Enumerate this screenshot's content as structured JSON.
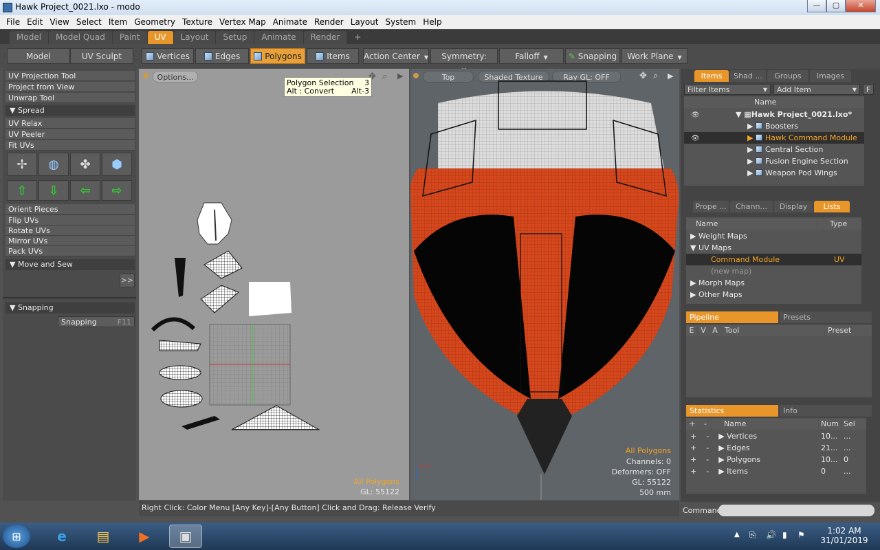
{
  "window": {
    "title": "Hawk Project_0021.lxo - modo",
    "min": "—",
    "max": "▢",
    "close": "✕"
  },
  "menu": [
    "File",
    "Edit",
    "View",
    "Select",
    "Item",
    "Geometry",
    "Texture",
    "Vertex Map",
    "Animate",
    "Render",
    "Layout",
    "System",
    "Help"
  ],
  "layout_tabs": [
    "Model",
    "Model Quad",
    "Paint",
    "UV",
    "Layout",
    "Setup",
    "Animate",
    "Render",
    "+"
  ],
  "active_layout_tab": "UV",
  "toolbar": {
    "model": "Model",
    "uv_sculpt": "UV Sculpt",
    "vertices": "Vertices",
    "edges": "Edges",
    "polygons": "Polygons",
    "items": "Items",
    "action_center": "Action Center",
    "symmetry": "Symmetry: Off",
    "falloff": "Falloff",
    "snapping": "Snapping",
    "work_plane": "Work Plane"
  },
  "left": {
    "tools1": [
      "UV Projection Tool",
      "Project from View",
      "Unwrap Tool"
    ],
    "spread": "Spread",
    "tools2": [
      "UV Relax",
      "UV Peeler",
      "Fit UVs"
    ],
    "tools3": [
      "Orient Pieces",
      "Flip UVs",
      "Rotate UVs",
      "Mirror UVs",
      "Pack UVs"
    ],
    "move_sew": "Move and Sew",
    "expand": ">>",
    "snapping_section": "Snapping",
    "snapping_btn": "Snapping",
    "snapping_key": "F11"
  },
  "uv_view": {
    "options": "Options...",
    "tooltip_title": "Polygon Selection",
    "tooltip_key1": "3",
    "tooltip_line2": "Alt : Convert",
    "tooltip_key2": "Alt-3",
    "all_polygons": "All Polygons",
    "gl": "GL: 55122"
  },
  "viewport": {
    "view": "Top",
    "shading": "Shaded Texture",
    "raygl": "Ray GL: OFF",
    "all_polygons": "All Polygons",
    "channels": "Channels: 0",
    "deformers": "Deformers: OFF",
    "gl": "GL: 55122",
    "scale": "500 mm"
  },
  "status": "Right Click: Color Menu  [Any Key]-[Any Button] Click and Drag: Release Verify",
  "items_panel": {
    "tabs": [
      "Items",
      "Shad ...",
      "Groups",
      "Images"
    ],
    "filter": "Filter Items",
    "add": "Add Item",
    "f": "F",
    "name_header": "Name",
    "rows": [
      {
        "label": "Hawk Project_0021.lxo*",
        "level": 0
      },
      {
        "label": "Boosters",
        "level": 1
      },
      {
        "label": "Hawk Command Module",
        "level": 1
      },
      {
        "label": "Central Section",
        "level": 1
      },
      {
        "label": "Fusion Engine Section",
        "level": 1
      },
      {
        "label": "Weapon Pod Wings",
        "level": 1
      }
    ]
  },
  "lists_panel": {
    "tabs": [
      "Prope ...",
      "Chann...",
      "Display",
      "Lists"
    ],
    "name": "Name",
    "type": "Type",
    "rows": [
      {
        "label": "Weight Maps",
        "type": ""
      },
      {
        "label": "UV Maps",
        "type": ""
      },
      {
        "label": "Command Module",
        "type": "UV"
      },
      {
        "label": "(new map)",
        "type": ""
      },
      {
        "label": "Morph Maps",
        "type": ""
      },
      {
        "label": "Other Maps",
        "type": ""
      }
    ]
  },
  "pipeline": {
    "tab1": "Pipeline",
    "tab2": "Presets",
    "cols": [
      "E",
      "V",
      "A",
      "Tool",
      "Preset"
    ]
  },
  "stats": {
    "tab1": "Statistics",
    "tab2": "Info",
    "cols": [
      "+",
      "-",
      "Name",
      "Num",
      "Sel"
    ],
    "rows": [
      {
        "name": "Vertices",
        "num": "10...",
        "sel": "..."
      },
      {
        "name": "Edges",
        "num": "21...",
        "sel": "..."
      },
      {
        "name": "Polygons",
        "num": "10...",
        "sel": "0"
      },
      {
        "name": "Items",
        "num": "0",
        "sel": "..."
      }
    ]
  },
  "command_label": "Command",
  "clock": {
    "time": "1:02 AM",
    "date": "31/01/2019"
  },
  "colors": {
    "accent": "#e8962a",
    "hull_orange": "#d6471c"
  }
}
